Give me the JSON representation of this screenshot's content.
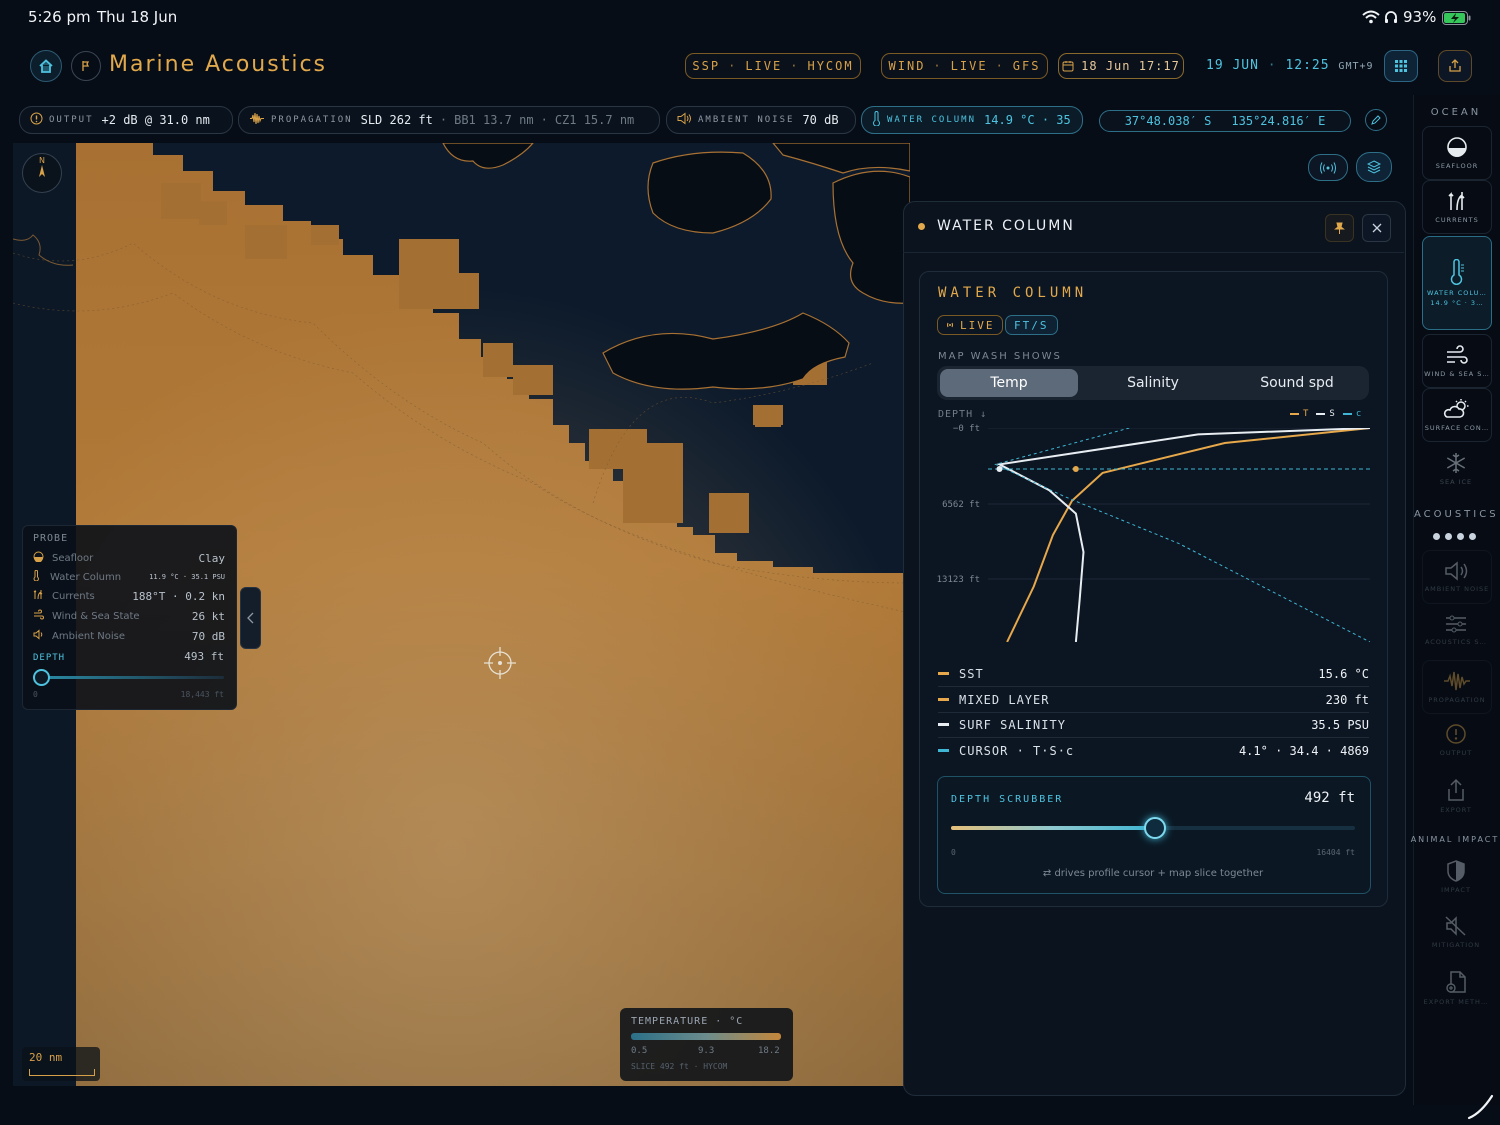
{
  "status_bar": {
    "time": "5:26 pm",
    "date": "Thu 18 Jun",
    "battery": "93%"
  },
  "header": {
    "app_title": "Marine Acoustics",
    "badges": [
      {
        "parts": [
          "SSP",
          "LIVE",
          "HYCOM"
        ]
      },
      {
        "parts": [
          "WIND",
          "LIVE",
          "GFS"
        ]
      }
    ],
    "datetime_picker": "18 Jun 17:17",
    "clock": {
      "date": "19 JUN",
      "time": "12:25",
      "tz": "GMT+9"
    }
  },
  "info_strip": {
    "output": {
      "label": "OUTPUT",
      "value": "+2 dB @ 31.0 nm"
    },
    "propagation": {
      "label": "PROPAGATION",
      "sld": "SLD 262 ft",
      "bb1": "BB1 13.7 nm",
      "cz1": "CZ1 15.7 nm"
    },
    "ambient": {
      "label": "AMBIENT NOISE",
      "value": "70 dB"
    },
    "water_column": {
      "label": "WATER COLUMN",
      "value": "14.9 °C · 35"
    },
    "coords": {
      "lat": "37°48.038′ S",
      "lon": "135°24.816′ E"
    }
  },
  "map": {
    "compass_letter": "N",
    "scale_label": "20 nm",
    "legend": {
      "title": "TEMPERATURE · °C",
      "min": "0.5",
      "mid": "9.3",
      "max": "18.2",
      "footer": "SLICE 492 ft · HYCOM"
    }
  },
  "probe": {
    "title": "PROBE",
    "rows": [
      {
        "icon": "seafloor-icon",
        "label": "Seafloor",
        "value": "Clay"
      },
      {
        "icon": "thermometer-icon",
        "label": "Water Column",
        "value": "11.9 °C · 35.1 PSU"
      },
      {
        "icon": "currents-icon",
        "label": "Currents",
        "value": "188°T · 0.2 kn"
      },
      {
        "icon": "wind-icon",
        "label": "Wind & Sea State",
        "value": "26 kt"
      },
      {
        "icon": "speaker-icon",
        "label": "Ambient Noise",
        "value": "70 dB"
      }
    ],
    "depth_label": "DEPTH",
    "depth_value": "493 ft",
    "depth_min": "0",
    "depth_max": "18,443 ft",
    "depth_fraction": 0.03
  },
  "panel": {
    "header_title": "WATER COLUMN",
    "card_title": "WATER COLUMN",
    "tags": [
      "LIVE",
      "FT/S"
    ],
    "map_wash_label": "MAP WASH SHOWS",
    "segments": [
      "Temp",
      "Salinity",
      "Sound spd"
    ],
    "selected_segment": "Temp",
    "depth_axis_label": "DEPTH ↓",
    "legend": {
      "t": "T",
      "s": "S",
      "c": "c"
    },
    "stats": [
      {
        "key": "SST",
        "value": "15.6 °C",
        "color": "#e6a84a"
      },
      {
        "key": "MIXED LAYER",
        "value": "230 ft",
        "color": "#e6a84a"
      },
      {
        "key": "SURF SALINITY",
        "value": "35.5 PSU",
        "color": "#e8edf2"
      },
      {
        "key": "CURSOR · T·S·c",
        "value": "4.1° · 34.4 · 4869",
        "color": "#3fb6d3"
      }
    ],
    "scrubber": {
      "label": "DEPTH SCRUBBER",
      "value": "492 ft",
      "min": "0",
      "max": "16404 ft",
      "hint": "⇄ drives profile cursor + map slice together",
      "fraction": 0.5
    }
  },
  "chart_data": {
    "type": "line",
    "ylabel": "DEPTH ↓",
    "y_ticks": [
      "−0 ft",
      "6562 ft",
      "13123 ft"
    ],
    "ylim": [
      0,
      16404
    ],
    "cursor_depth_ft": 492,
    "series": [
      {
        "name": "T",
        "color": "#e6a84a",
        "points": [
          [
            1.0,
            0
          ],
          [
            0.62,
            7
          ],
          [
            0.3,
            21
          ],
          [
            0.22,
            34
          ],
          [
            0.17,
            50
          ],
          [
            0.12,
            74
          ],
          [
            0.05,
            100
          ]
        ]
      },
      {
        "name": "S",
        "color": "#e8edf2",
        "points": [
          [
            1.0,
            0
          ],
          [
            0.55,
            3
          ],
          [
            0.03,
            17
          ],
          [
            0.16,
            29
          ],
          [
            0.23,
            40
          ],
          [
            0.25,
            58
          ],
          [
            0.24,
            80
          ],
          [
            0.23,
            100
          ]
        ]
      },
      {
        "name": "c",
        "color": "#3fb6d3",
        "points": [
          [
            0.37,
            0
          ],
          [
            0.02,
            17
          ],
          [
            0.2,
            32
          ],
          [
            0.5,
            54
          ],
          [
            1.0,
            100
          ]
        ]
      }
    ]
  },
  "rail": {
    "ocean_header": "OCEAN",
    "ocean_items": [
      {
        "icon": "seafloor-icon",
        "label": "SEAFLOOR"
      },
      {
        "icon": "currents-icon",
        "label": "CURRENTS"
      },
      {
        "icon": "thermometer-icon",
        "label": "WATER COLU…",
        "sub": "14.9 °C · 3…"
      },
      {
        "icon": "wind-icon",
        "label": "WIND & SEA S…"
      },
      {
        "icon": "cloud-sun-icon",
        "label": "SURFACE CON…"
      },
      {
        "icon": "snowflake-icon",
        "label": "SEA ICE"
      }
    ],
    "acoustics_header": "ACOUSTICS",
    "acoustics_items": [
      {
        "icon": "speaker-icon",
        "label": "AMBIENT NOISE"
      },
      {
        "icon": "sliders-icon",
        "label": "ACOUSTICS S…"
      },
      {
        "icon": "waveform-icon",
        "label": "PROPAGATION"
      },
      {
        "icon": "output-icon",
        "label": "OUTPUT"
      },
      {
        "icon": "share-icon",
        "label": "EXPORT"
      }
    ],
    "animal_header": "ANIMAL IMPACT",
    "animal_items": [
      {
        "icon": "shield-icon",
        "label": "IMPACT"
      },
      {
        "icon": "mute-icon",
        "label": "MITIGATION"
      },
      {
        "icon": "export-doc-icon",
        "label": "EXPORT METH…"
      }
    ]
  }
}
